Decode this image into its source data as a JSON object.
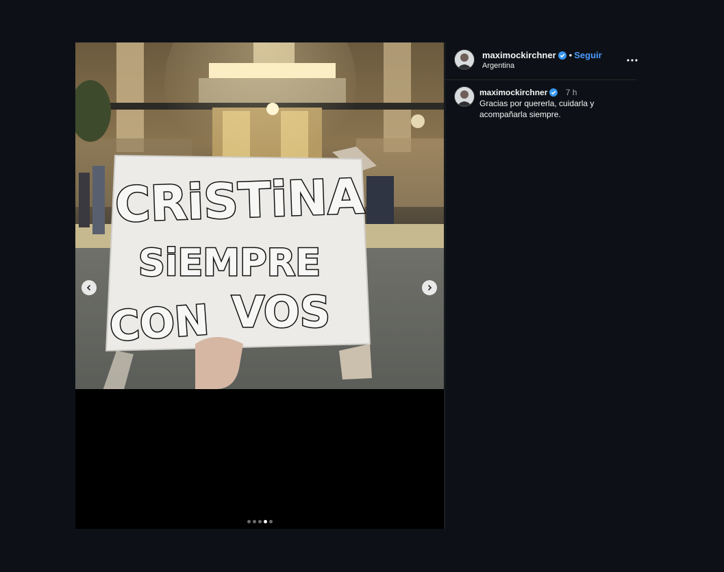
{
  "post": {
    "username": "maximockirchner",
    "verified": true,
    "bullet": "•",
    "follow_label": "Seguir",
    "location": "Argentina",
    "more_icon": "more-options-icon",
    "carousel": {
      "total": 5,
      "current": 4,
      "prev_icon": "chevron-left-icon",
      "next_icon": "chevron-right-icon"
    },
    "image": {
      "sign_lines": [
        "CRiSTiNA",
        "SiEMPRE",
        "CON",
        "VOS"
      ]
    }
  },
  "caption": {
    "username": "maximockirchner",
    "time": "7 h",
    "text": "Gracias por quererla, cuidarla y acompañarla siempre."
  },
  "colors": {
    "background": "#0d1117",
    "follow": "#4a9bff",
    "verified": "#3897f0"
  }
}
